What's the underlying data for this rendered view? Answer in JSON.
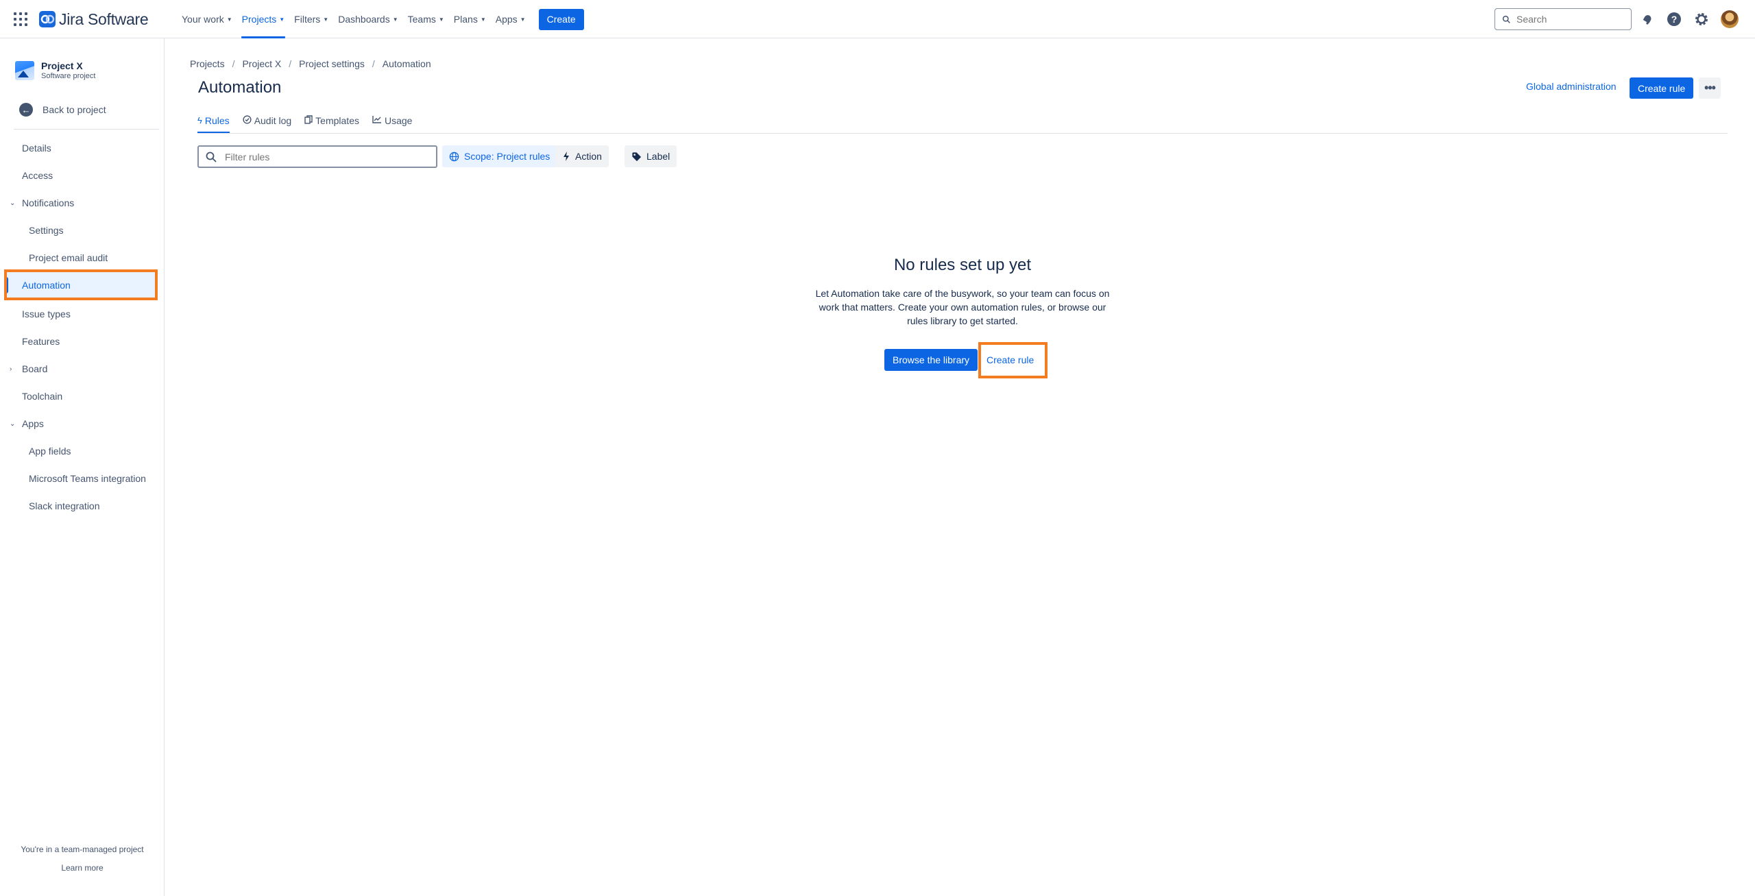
{
  "topnav": {
    "logo_text": "Jira Software",
    "items": [
      {
        "label": "Your work"
      },
      {
        "label": "Projects"
      },
      {
        "label": "Filters"
      },
      {
        "label": "Dashboards"
      },
      {
        "label": "Teams"
      },
      {
        "label": "Plans"
      },
      {
        "label": "Apps"
      }
    ],
    "create_label": "Create",
    "search_placeholder": "Search"
  },
  "sidebar": {
    "project_name": "Project X",
    "project_type": "Software project",
    "back_label": "Back to project",
    "items": [
      {
        "label": "Details"
      },
      {
        "label": "Access"
      },
      {
        "label": "Notifications"
      },
      {
        "label": "Settings"
      },
      {
        "label": "Project email audit"
      },
      {
        "label": "Automation"
      },
      {
        "label": "Issue types"
      },
      {
        "label": "Features"
      },
      {
        "label": "Board"
      },
      {
        "label": "Toolchain"
      },
      {
        "label": "Apps"
      },
      {
        "label": "App fields"
      },
      {
        "label": "Microsoft Teams integration"
      },
      {
        "label": "Slack integration"
      }
    ],
    "footer_text": "You're in a team-managed project",
    "footer_link": "Learn more"
  },
  "breadcrumbs": [
    "Projects",
    "Project X",
    "Project settings",
    "Automation"
  ],
  "header": {
    "title": "Automation",
    "global_admin_label": "Global administration",
    "create_rule_label": "Create rule"
  },
  "tabs": [
    {
      "label": "Rules"
    },
    {
      "label": "Audit log"
    },
    {
      "label": "Templates"
    },
    {
      "label": "Usage"
    }
  ],
  "filters": {
    "search_placeholder": "Filter rules",
    "scope_label": "Scope: Project rules",
    "action_label": "Action",
    "label_label": "Label"
  },
  "empty_state": {
    "title": "No rules set up yet",
    "description": "Let Automation take care of the busywork, so your team can focus on work that matters. Create your own automation rules, or browse our rules library to get started.",
    "browse_label": "Browse the library",
    "create_label": "Create rule"
  },
  "colors": {
    "accent": "#0c66e4",
    "highlight": "#f47c20",
    "text": "#172b4d",
    "subtle_text": "#44546f"
  }
}
